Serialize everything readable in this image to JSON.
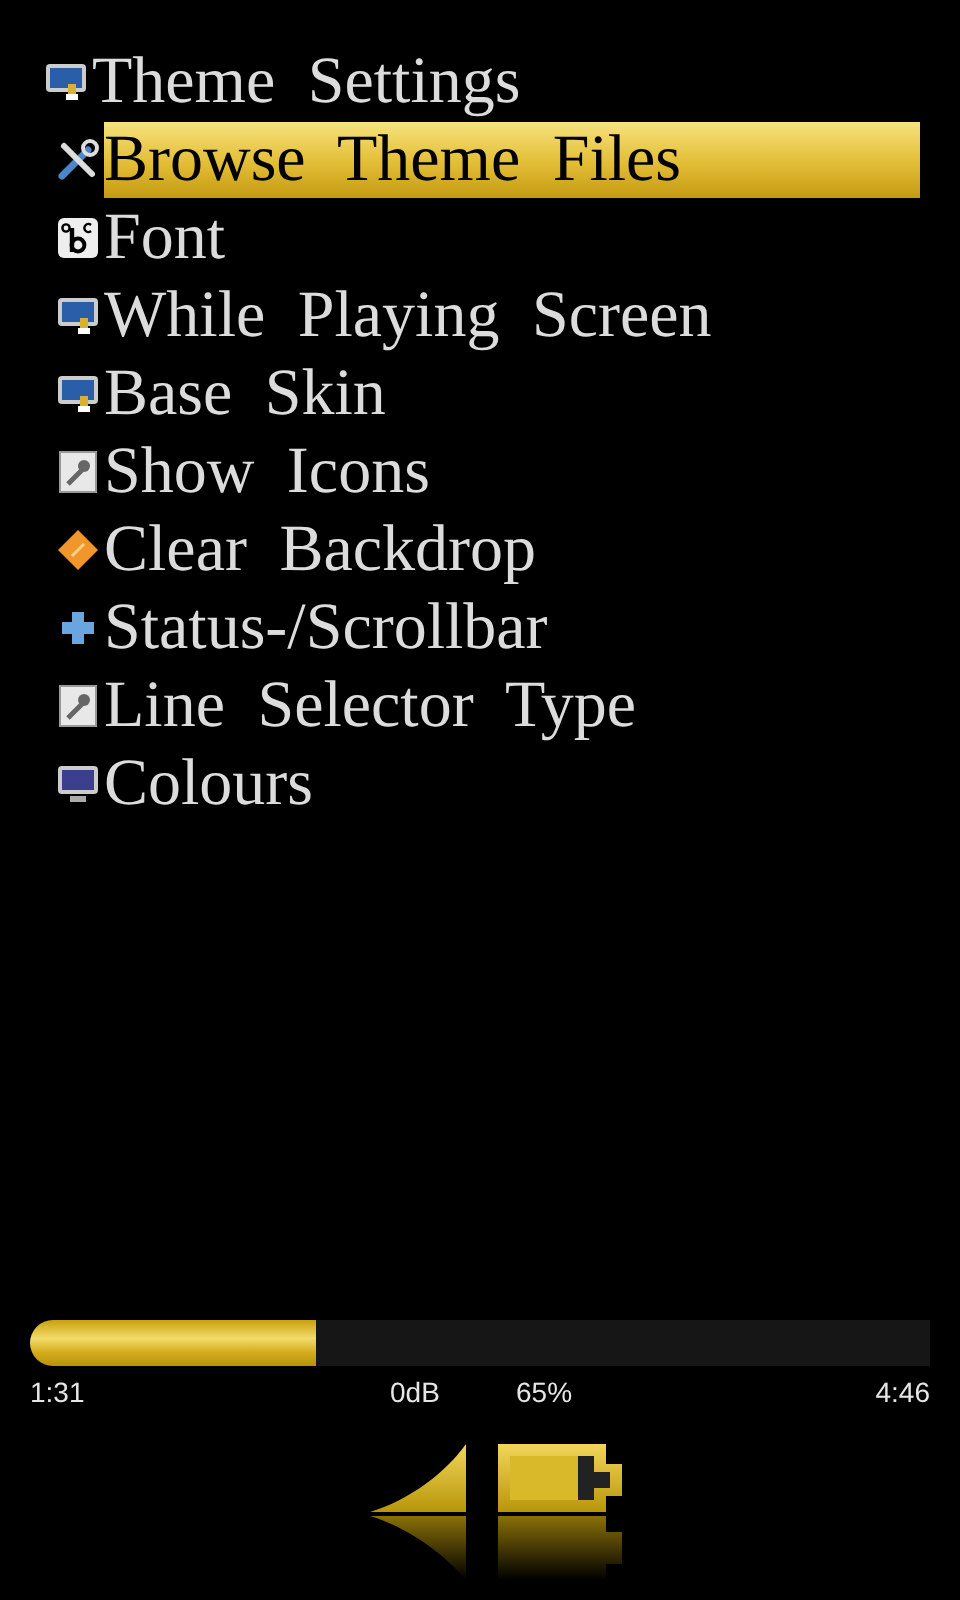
{
  "menu": {
    "title": {
      "label": "Theme Settings",
      "kind": "monitor-brush"
    },
    "items": [
      {
        "label": "Browse Theme Files",
        "kind": "tools",
        "selected": true
      },
      {
        "label": "Font",
        "kind": "font",
        "selected": false
      },
      {
        "label": "While Playing Screen",
        "kind": "monitor-brush",
        "selected": false
      },
      {
        "label": "Base Skin",
        "kind": "monitor-brush",
        "selected": false
      },
      {
        "label": "Show Icons",
        "kind": "document-wrench",
        "selected": false
      },
      {
        "label": "Clear Backdrop",
        "kind": "diamond",
        "selected": false
      },
      {
        "label": "Status-/Scrollbar",
        "kind": "plus",
        "selected": false
      },
      {
        "label": "Line Selector Type",
        "kind": "document-wrench",
        "selected": false
      },
      {
        "label": "Colours",
        "kind": "monitor",
        "selected": false
      }
    ]
  },
  "playback": {
    "level": 0.318,
    "elapsed": "1:31",
    "volume": "0dB",
    "battery": "65%",
    "total": "4:46"
  }
}
